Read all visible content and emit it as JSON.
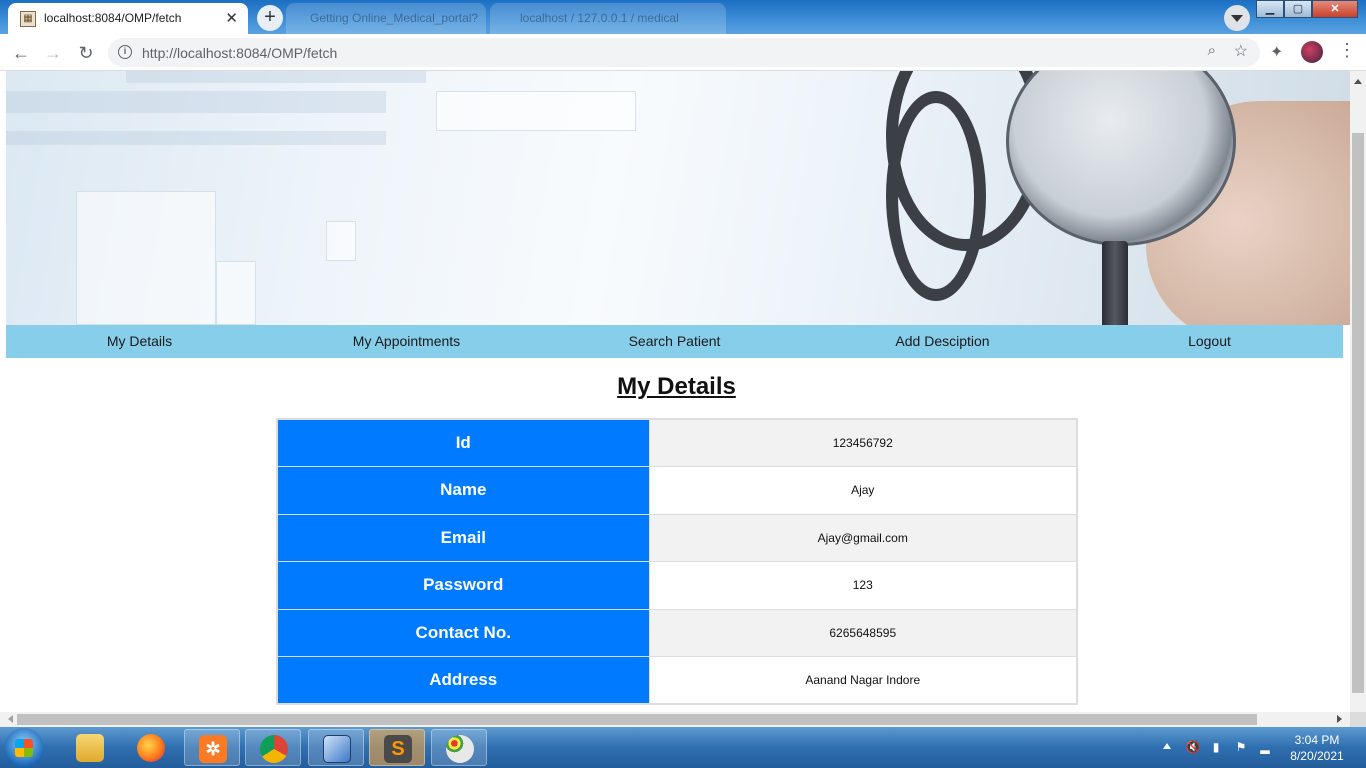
{
  "browser": {
    "active_tab_title": "localhost:8084/OMP/fetch",
    "background_tab_titles": [
      "Getting Online_Medical_portal?",
      "localhost / 127.0.0.1 / medical"
    ],
    "url": "http://localhost:8084/OMP/fetch",
    "window_controls": [
      "minimize",
      "maximize",
      "close"
    ]
  },
  "nav": {
    "items": [
      "My Details",
      "My Appointments",
      "Search Patient",
      "Add Desciption",
      "Logout"
    ]
  },
  "page": {
    "heading": "My Details",
    "rows": [
      {
        "label": "Id",
        "value": "123456792"
      },
      {
        "label": "Name",
        "value": "Ajay"
      },
      {
        "label": "Email",
        "value": "Ajay@gmail.com"
      },
      {
        "label": "Password",
        "value": "123"
      },
      {
        "label": "Contact No.",
        "value": "6265648595"
      },
      {
        "label": "Address",
        "value": "Aanand Nagar Indore"
      }
    ]
  },
  "taskbar": {
    "apps": [
      "file-explorer",
      "firefox",
      "xampp",
      "chrome",
      "virtualbox",
      "sublime-text",
      "paint"
    ],
    "time": "3:04 PM",
    "date": "8/20/2021"
  },
  "colors": {
    "nav_bg": "#87ceeb",
    "label_cell_bg": "#007bff"
  }
}
